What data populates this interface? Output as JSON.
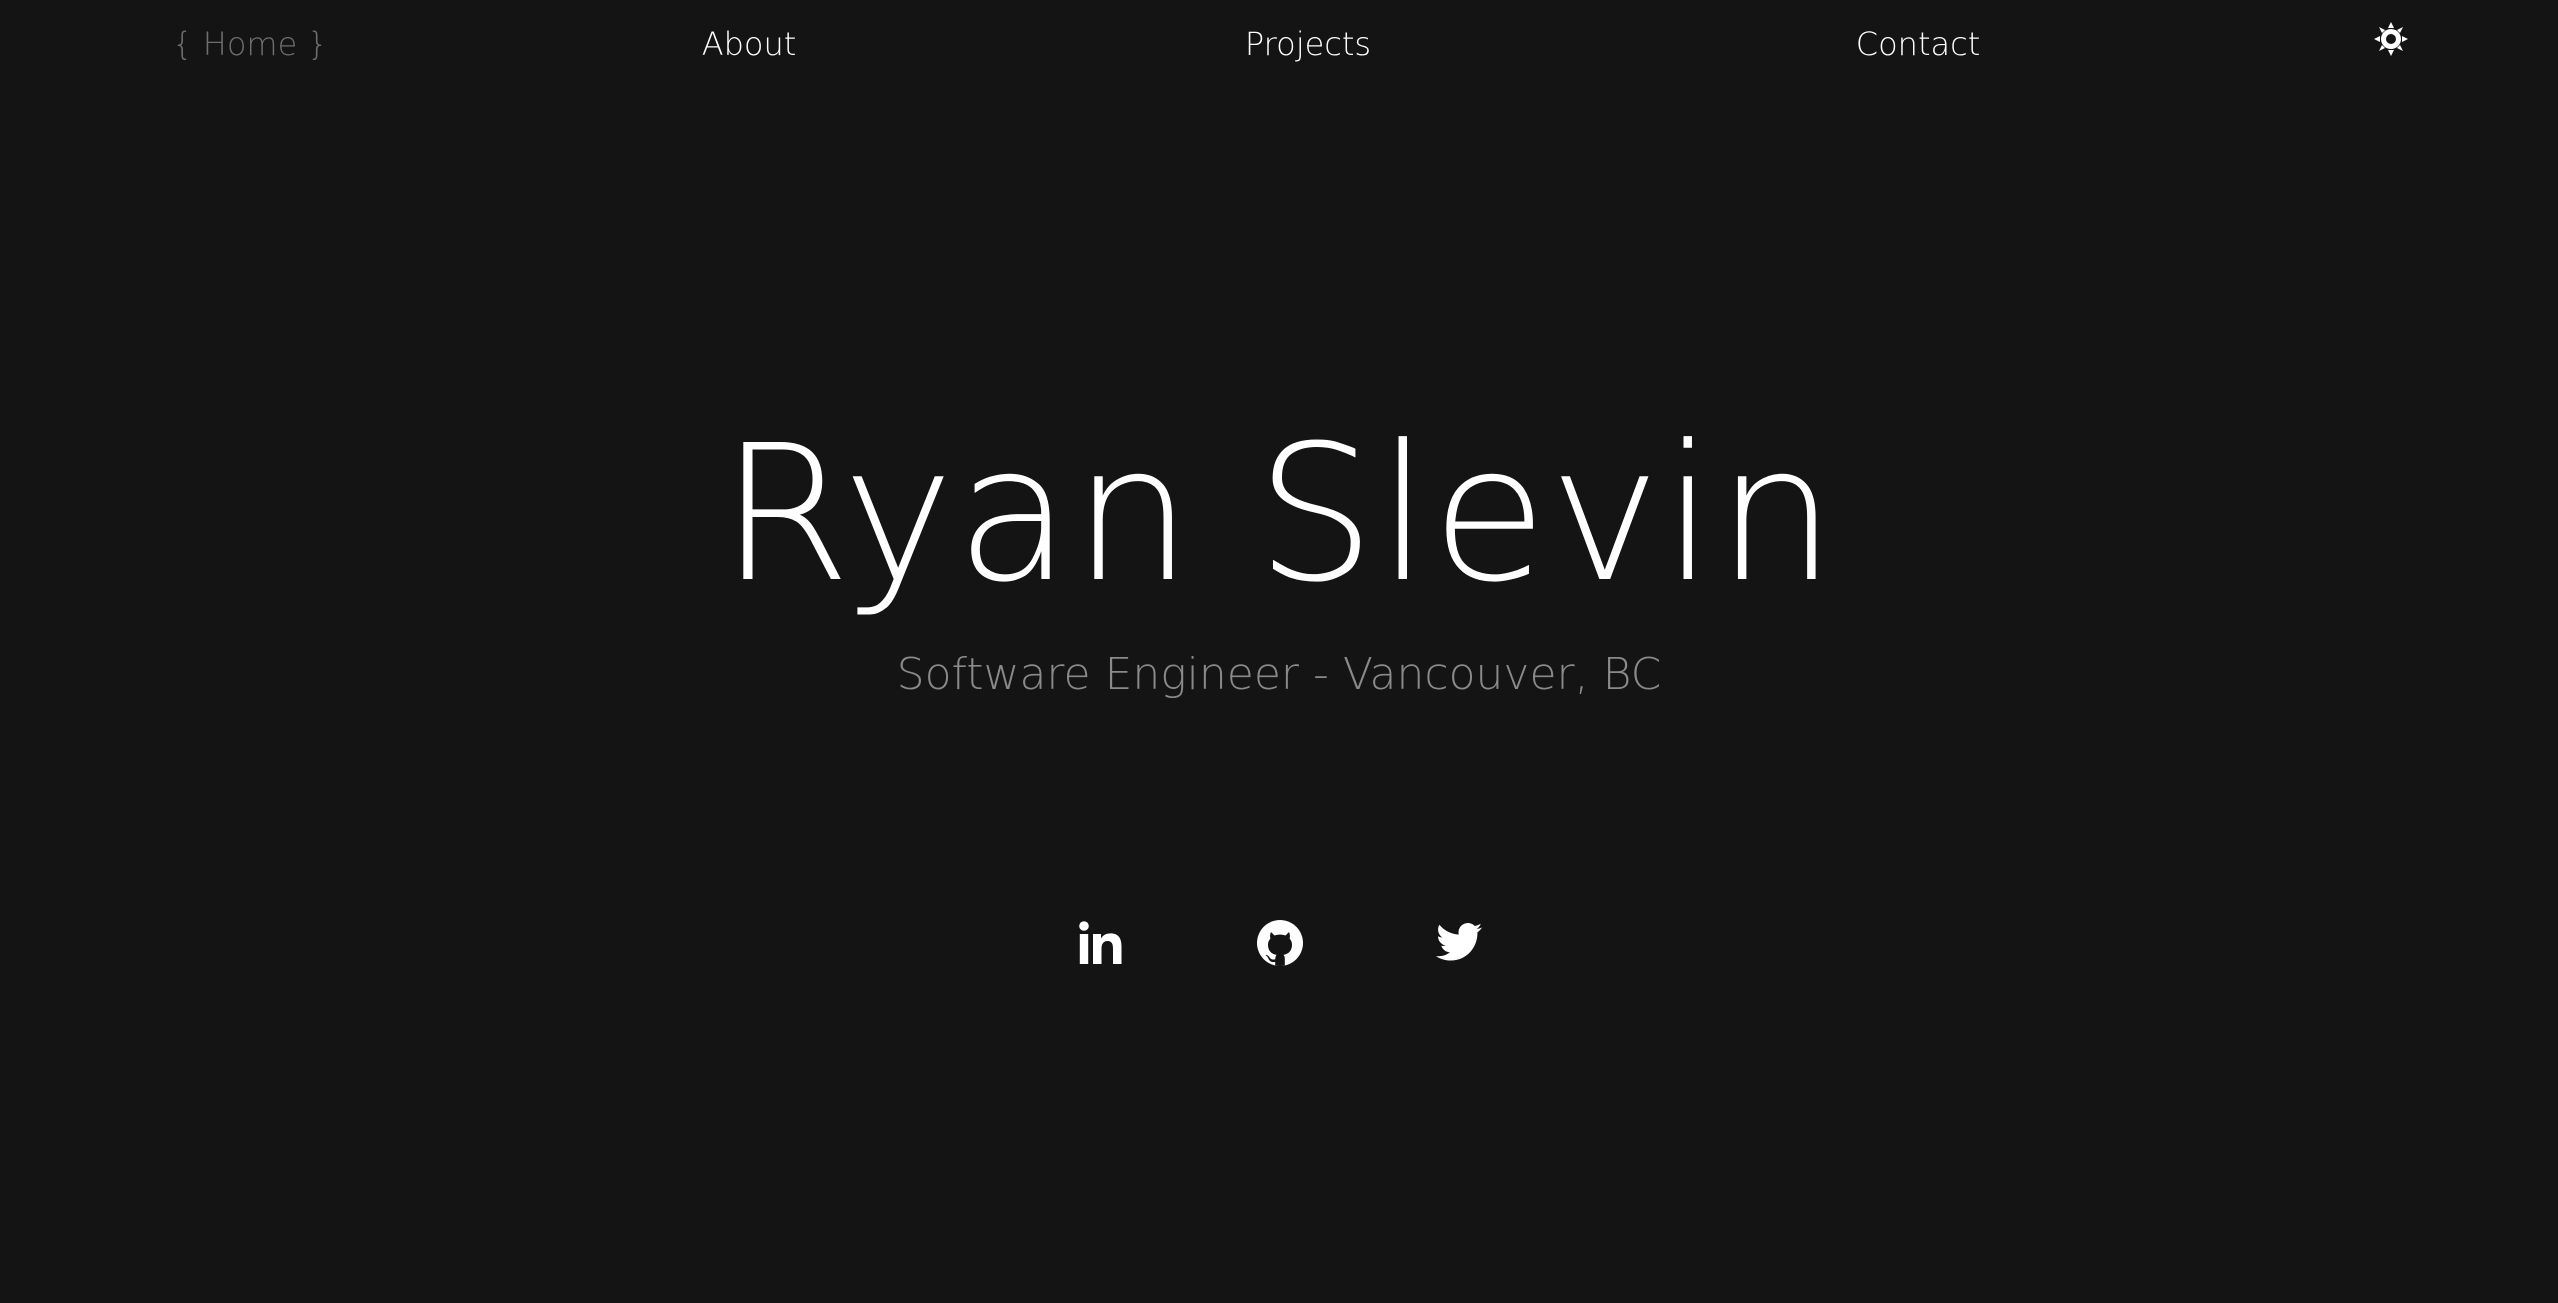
{
  "nav": {
    "home_label": "{ Home }",
    "about_label": "About",
    "projects_label": "Projects",
    "contact_label": "Contact",
    "theme_toggle_icon": "sun-icon"
  },
  "hero": {
    "name": "Ryan Slevin",
    "subtitle": "Software Engineer - Vancouver, BC"
  },
  "social": {
    "icons": [
      "linkedin-icon",
      "github-icon",
      "twitter-icon"
    ]
  },
  "colors": {
    "background": "#141414",
    "text": "#ffffff",
    "muted": "#6e6e6e",
    "subtitle": "#8a8a8a"
  }
}
